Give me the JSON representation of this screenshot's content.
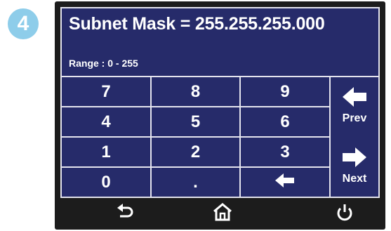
{
  "step": {
    "number": "4",
    "color": "#8ecdea"
  },
  "screen": {
    "title": "Subnet Mask = 255.255.255.000",
    "range": "Range : 0 - 255",
    "background": "#262b6a"
  },
  "keypad": {
    "rows": [
      [
        "7",
        "8",
        "9"
      ],
      [
        "4",
        "5",
        "6"
      ],
      [
        "1",
        "2",
        "3"
      ],
      [
        "0",
        ".",
        "backspace-arrow-icon"
      ]
    ],
    "prev_label": "Prev",
    "next_label": "Next"
  },
  "footer": {
    "icons": [
      "back-icon",
      "home-icon",
      "power-icon"
    ]
  }
}
